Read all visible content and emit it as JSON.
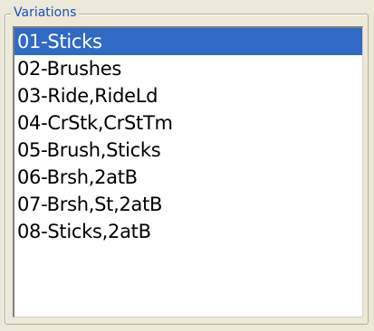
{
  "group": {
    "title": "Variations"
  },
  "list": {
    "selected_index": 0,
    "items": [
      "01-Sticks",
      "02-Brushes",
      "03-Ride,RideLd",
      "04-CrStk,CrStTm",
      "05-Brush,Sticks",
      "06-Brsh,2atB",
      "07-Brsh,St,2atB",
      "08-Sticks,2atB"
    ]
  },
  "colors": {
    "selection": "#316ac5",
    "title_text": "#1a4fbd",
    "dialog_background": "#ece9d8"
  }
}
